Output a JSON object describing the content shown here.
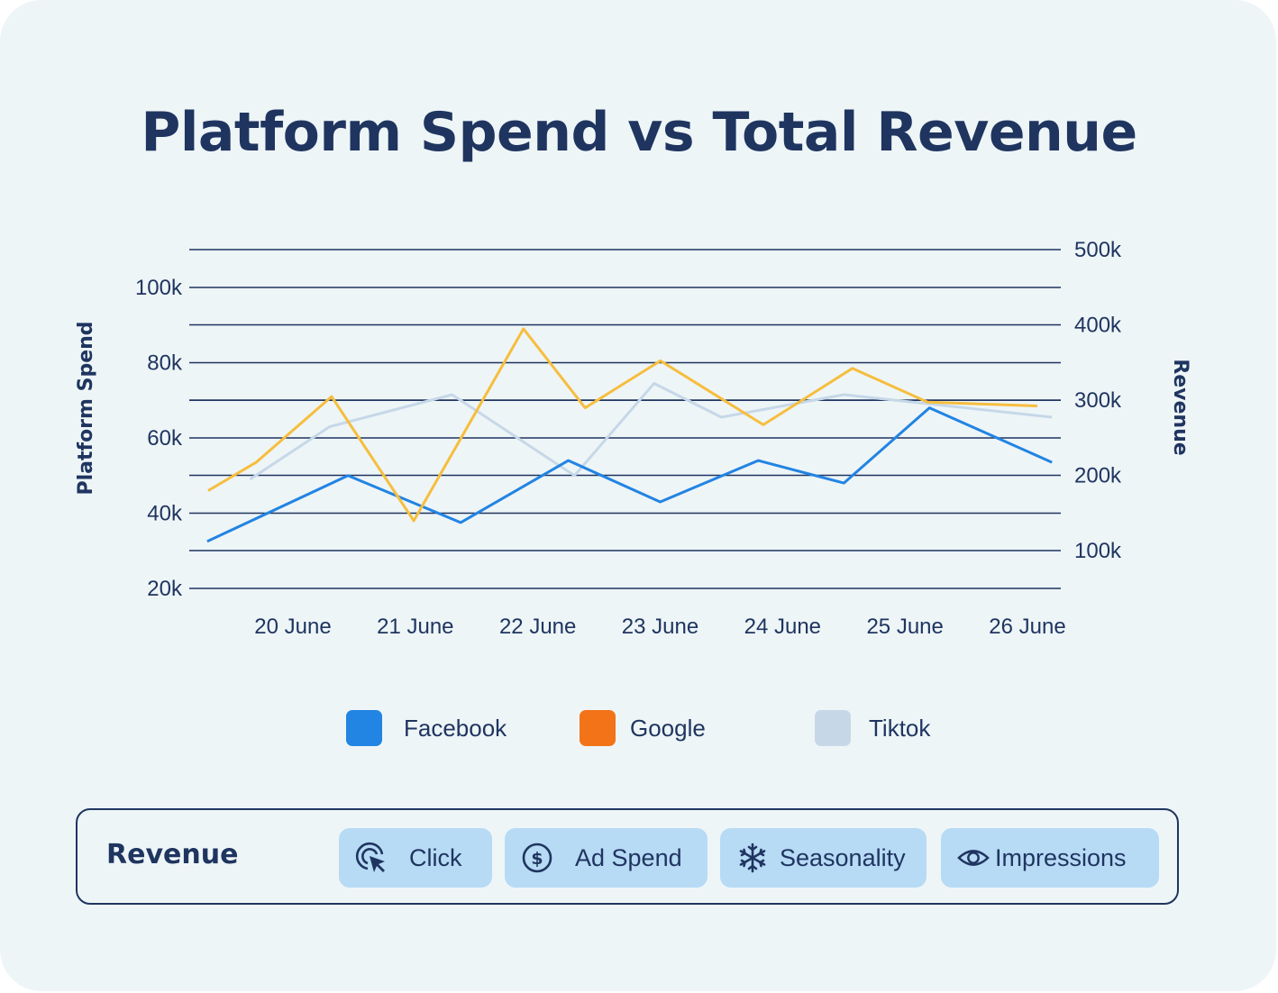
{
  "title": "Platform Spend vs Total Revenue",
  "colors": {
    "text": "#1f3560",
    "facebook": "#2284e3",
    "google_line": "#f6be3e",
    "google_swatch": "#f27318",
    "tiktok": "#c6d8e8",
    "chip": "#b7daf5",
    "background": "#eef5f7"
  },
  "chart_data": {
    "type": "line",
    "title": "Platform Spend vs Total Revenue",
    "ylabel": "Platform Spend",
    "y2label": "Revenue",
    "xlabel": "",
    "categories": [
      "20 June",
      "21 June",
      "22 June",
      "23 June",
      "24 June",
      "25 June",
      "26 June"
    ],
    "y_ticks": [
      "100k",
      "80k",
      "60k",
      "40k",
      "20k"
    ],
    "y_tick_values": [
      100,
      80,
      60,
      40,
      20
    ],
    "y2_ticks": [
      "500k",
      "400k",
      "300k",
      "200k",
      "100k"
    ],
    "y2_tick_values": [
      500,
      400,
      300,
      200,
      100
    ],
    "ylim": [
      20,
      110
    ],
    "y2lim": [
      50,
      500
    ],
    "grid": true,
    "legend_position": "bottom",
    "x_range": [
      19.2,
      26.35
    ],
    "series": [
      {
        "name": "Facebook",
        "color": "#2284e3",
        "x": [
          19.3,
          20.45,
          21.37,
          22.25,
          23.0,
          23.8,
          24.5,
          25.2,
          26.2
        ],
        "y": [
          32.5,
          50,
          37.5,
          54,
          43,
          54,
          48,
          68,
          53.5
        ]
      },
      {
        "name": "Google",
        "color": "#f6be3e",
        "x": [
          19.3,
          19.65,
          20.2,
          20.8,
          21.6,
          22.05,
          22.6,
          23.35,
          24.0,
          24.55,
          25.35
        ],
        "y": [
          46,
          53.5,
          71,
          38,
          89,
          68,
          80.5,
          63.5,
          78.5,
          69.5,
          68.5
        ],
        "visible_range": [
          19.3,
          26.2
        ]
      },
      {
        "name": "Tiktok",
        "color": "#c6d8e8",
        "x": [
          19.65,
          20.3,
          21.3,
          22.3,
          22.95,
          23.5,
          24.5,
          26.2
        ],
        "y": [
          49,
          63,
          71.5,
          50,
          74.5,
          65.5,
          71.5,
          65.5
        ]
      }
    ]
  },
  "legend": [
    {
      "label": "Facebook",
      "color": "#2284e3"
    },
    {
      "label": "Google",
      "color": "#f27318"
    },
    {
      "label": "Tiktok",
      "color": "#c6d8e8"
    }
  ],
  "panel": {
    "title": "Revenue",
    "chips": [
      {
        "label": "Click",
        "icon": "cursor-click-icon"
      },
      {
        "label": "Ad Spend",
        "icon": "dollar-coin-icon"
      },
      {
        "label": "Seasonality",
        "icon": "snowflake-icon"
      },
      {
        "label": "Impressions",
        "icon": "eye-icon"
      }
    ]
  }
}
